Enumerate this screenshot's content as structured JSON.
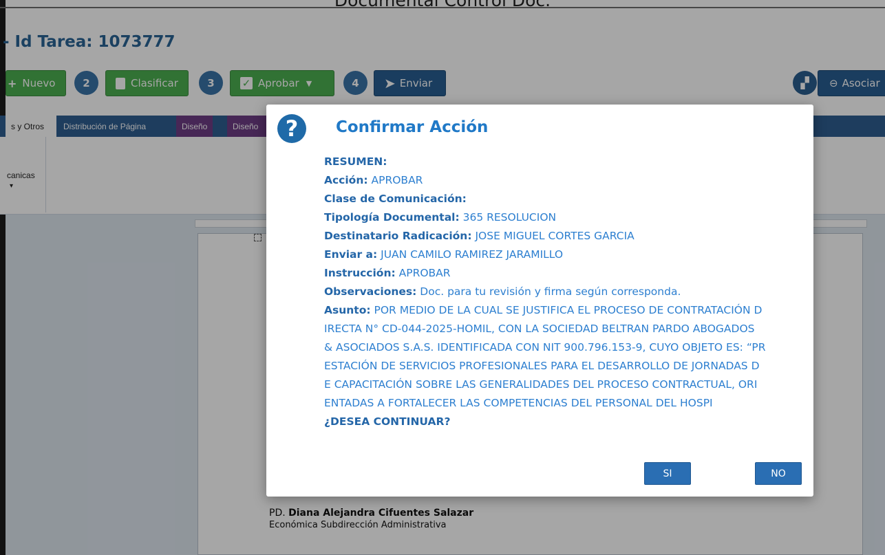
{
  "header": {
    "window_title": "Documental Control Doc.",
    "task_title": "- Id Tarea: 1073777"
  },
  "toolbar": {
    "new_label": "Nuevo",
    "step2": "2",
    "classify_label": "Clasificar",
    "step3": "3",
    "approve_label": "Aprobar",
    "step4": "4",
    "send_label": "Enviar",
    "associate_label": "Asociar"
  },
  "ribbon": {
    "tabs": [
      {
        "label": "s y Otros"
      },
      {
        "label": "Distribución de Página"
      },
      {
        "label": "Diseño"
      },
      {
        "label": "Diseño"
      }
    ],
    "group_label": "canicas"
  },
  "document": {
    "signer_prefix": "PD. ",
    "signer_name": "Diana Alejandra Cifuentes Salazar",
    "signer_role": "Económica Subdirección Administrativa"
  },
  "dialog": {
    "title": "Confirmar Acción",
    "summary_heading": "RESUMEN:",
    "fields": [
      {
        "label": "Acción:",
        "value": "APROBAR"
      },
      {
        "label": "Clase de Comunicación:",
        "value": ""
      },
      {
        "label": "Tipología Documental:",
        "value": "365 RESOLUCION"
      },
      {
        "label": "Destinatario Radicación:",
        "value": "JOSE MIGUEL CORTES GARCIA"
      },
      {
        "label": "Enviar a:",
        "value": "JUAN CAMILO RAMIREZ JARAMILLO"
      },
      {
        "label": "Instrucción:",
        "value": "APROBAR"
      },
      {
        "label": "Observaciones:",
        "value": "Doc. para tu revisión y firma según corresponda."
      }
    ],
    "subject_label": "Asunto:",
    "subject_lines": [
      "POR MEDIO DE LA CUAL SE JUSTIFICA EL PROCESO DE CONTRATACIÓN D",
      "IRECTA N° CD-044-2025-HOMIL, CON LA SOCIEDAD BELTRAN PARDO ABOGADOS",
      "& ASOCIADOS S.A.S. IDENTIFICADA CON NIT 900.796.153-9, CUYO OBJETO ES: “PR",
      "ESTACIÓN DE SERVICIOS PROFESIONALES PARA EL DESARROLLO DE JORNADAS D",
      "E CAPACITACIÓN SOBRE LAS GENERALIDADES DEL PROCESO CONTRACTUAL, ORI",
      "ENTADAS A FORTALECER LAS COMPETENCIAS DEL PERSONAL DEL HOSPI"
    ],
    "question": "¿DESEA CONTINUAR?",
    "yes_label": "SI",
    "no_label": "NO"
  }
}
